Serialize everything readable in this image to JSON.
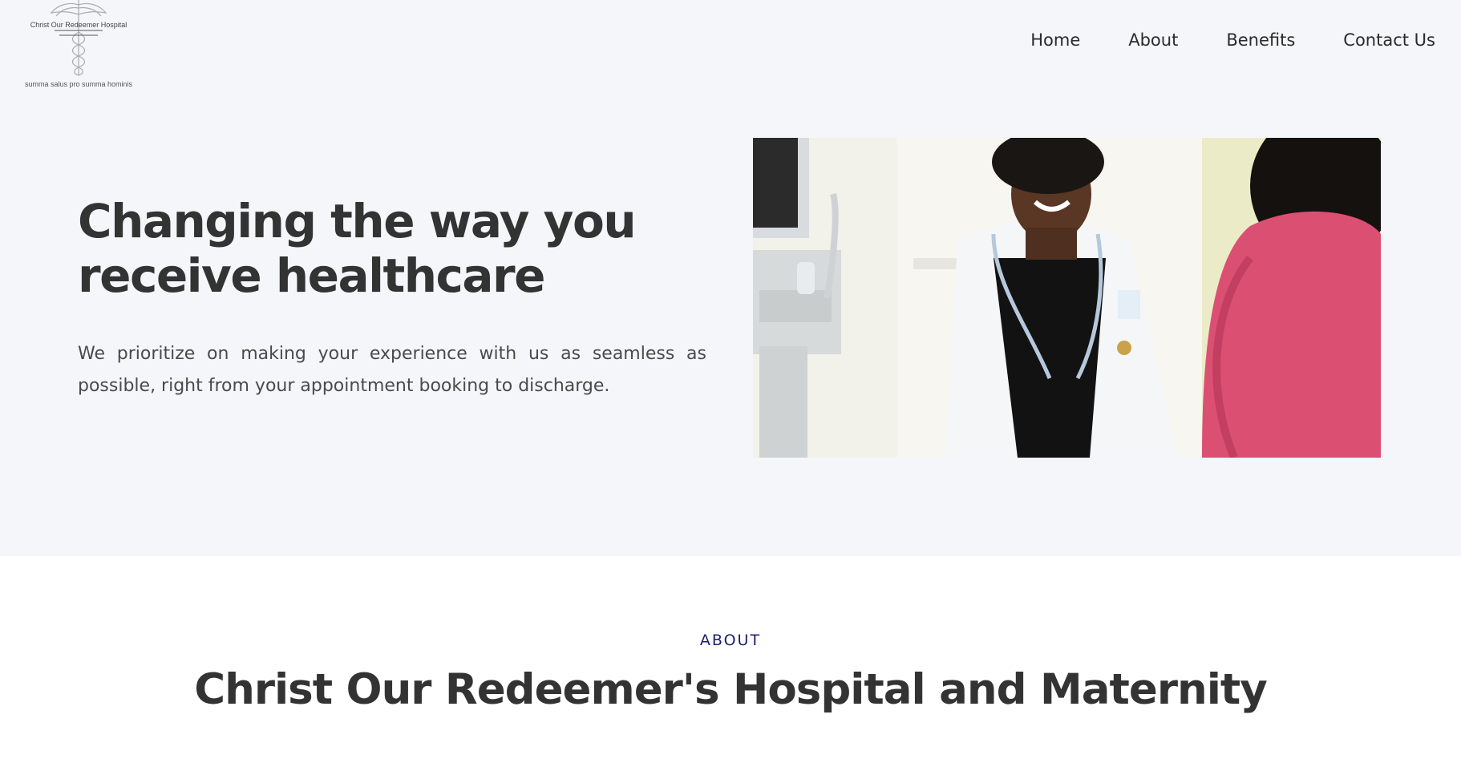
{
  "logo": {
    "name": "Christ Our Redeemer Hospital",
    "motto": "summa salus pro summa hominis"
  },
  "nav": {
    "items": [
      "Home",
      "About",
      "Benefits",
      "Contact Us"
    ]
  },
  "hero": {
    "title": "Changing the way you receive healthcare",
    "text": "We prioritize on making your experience with us as seamless as possible, right from your appointment booking to discharge.",
    "image_alt": "Doctor smiling at patient"
  },
  "about": {
    "label": "ABOUT",
    "title": "Christ Our Redeemer's Hospital and Maternity"
  },
  "colors": {
    "hero_background": "#f4f6f9",
    "heading": "#333333",
    "accent": "#1c1f6e"
  }
}
